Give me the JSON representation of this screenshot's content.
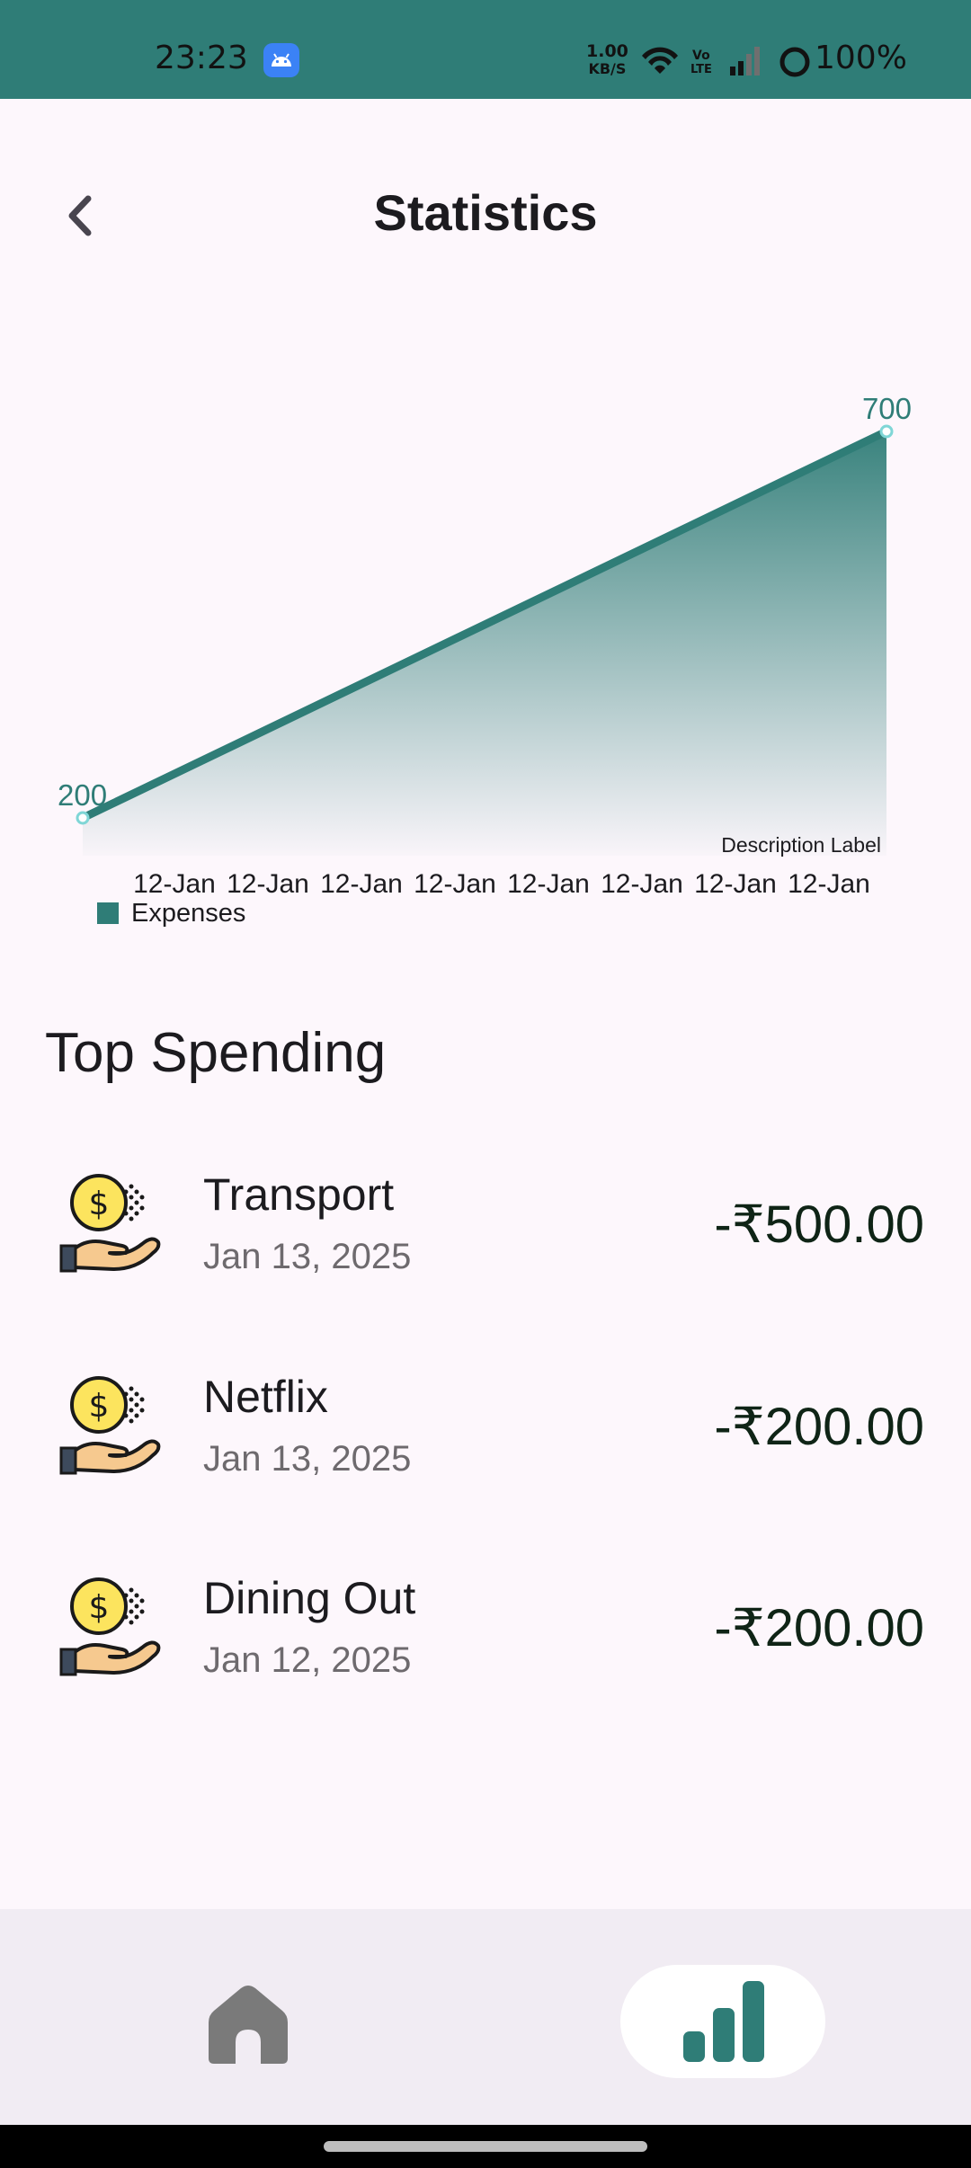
{
  "status_bar": {
    "time": "23:23",
    "speed_value": "1.00",
    "speed_unit": "KB/S",
    "battery": "100%",
    "background": "#2F7D77"
  },
  "header": {
    "title": "Statistics",
    "back_icon": "chevron-left-icon"
  },
  "chart_data": {
    "type": "area",
    "categories": [
      "12-Jan",
      "12-Jan",
      "12-Jan",
      "12-Jan",
      "12-Jan",
      "12-Jan",
      "12-Jan",
      "12-Jan"
    ],
    "points": [
      {
        "label": "200",
        "value": 200
      },
      {
        "label": "700",
        "value": 700
      }
    ],
    "series": [
      {
        "name": "Expenses",
        "values": [
          200,
          700
        ]
      }
    ],
    "legend": "Expenses",
    "description": "Description Label",
    "color": "#2F7D77",
    "grid": false,
    "legend_position": "bottom-left"
  },
  "top_spending": {
    "title": "Top Spending",
    "items": [
      {
        "name": "Transport",
        "date": "Jan 13, 2025",
        "amount": "-₹500.00",
        "icon": "money-hand-icon"
      },
      {
        "name": "Netflix",
        "date": "Jan 13, 2025",
        "amount": "-₹200.00",
        "icon": "money-hand-icon"
      },
      {
        "name": "Dining Out",
        "date": "Jan 12, 2025",
        "amount": "-₹200.00",
        "icon": "money-hand-icon"
      }
    ]
  },
  "bottom_nav": {
    "items": [
      {
        "icon": "home-icon",
        "active": false
      },
      {
        "icon": "bar-chart-icon",
        "active": true
      }
    ],
    "accent": "#2F7D77"
  }
}
